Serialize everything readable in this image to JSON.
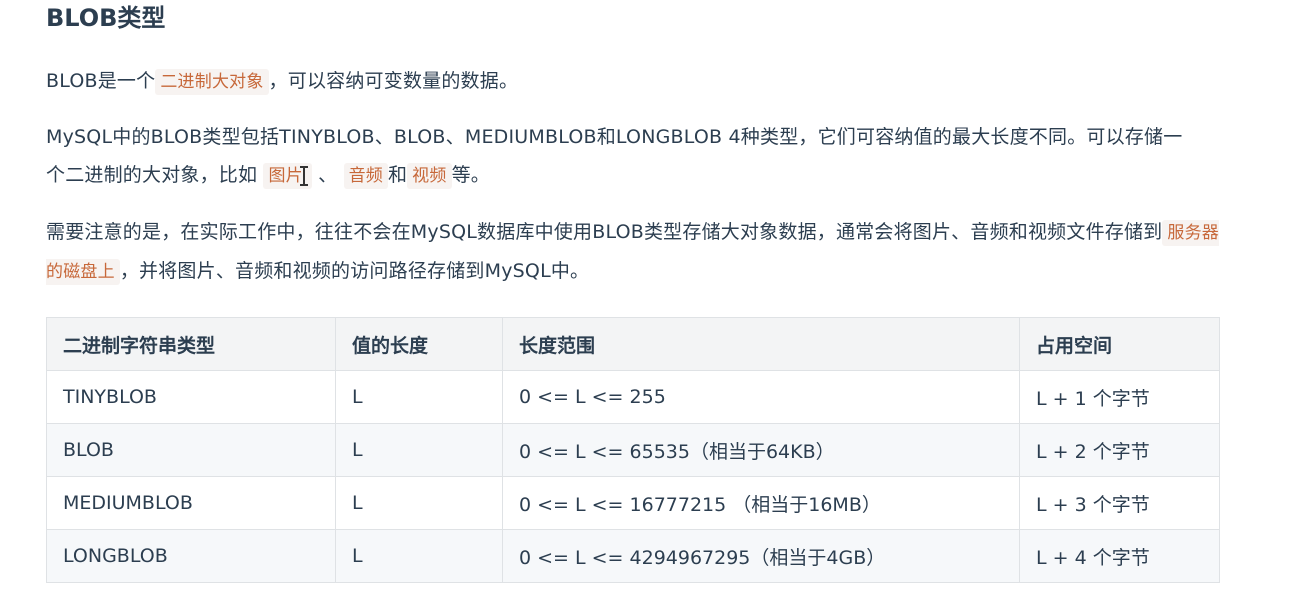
{
  "heading": "BLOB类型",
  "p1": {
    "pre": "BLOB是一个",
    "code": "二进制大对象",
    "post": "，可以容纳可变数量的数据。"
  },
  "p2": {
    "text1": "MySQL中的BLOB类型包括TINYBLOB、BLOB、MEDIUMBLOB和LONGBLOB 4种类型，它们可容纳值的最大长度不同。可以存储一个二进制的大对象，比如",
    "code1": "图片",
    "sep1": "、",
    "code2": "音频",
    "and": "和",
    "code3": "视频",
    "end": "等。"
  },
  "p3": {
    "text1": "需要注意的是，在实际工作中，往往不会在MySQL数据库中使用BLOB类型存储大对象数据，通常会将图片、音频和视频文件存储到",
    "code": "服务器的磁盘上",
    "text2": "，并将图片、音频和视频的访问路径存储到MySQL中。"
  },
  "table": {
    "headers": [
      "二进制字符串类型",
      "值的长度",
      "长度范围",
      "占用空间"
    ],
    "rows": [
      [
        "TINYBLOB",
        "L",
        "0 <= L <= 255",
        "L + 1 个字节"
      ],
      [
        "BLOB",
        "L",
        "0 <= L <= 65535（相当于64KB）",
        "L + 2 个字节"
      ],
      [
        "MEDIUMBLOB",
        "L",
        "0 <= L <= 16777215 （相当于16MB）",
        "L + 3 个字节"
      ],
      [
        "LONGBLOB",
        "L",
        "0 <= L <= 4294967295（相当于4GB）",
        "L + 4 个字节"
      ]
    ]
  }
}
